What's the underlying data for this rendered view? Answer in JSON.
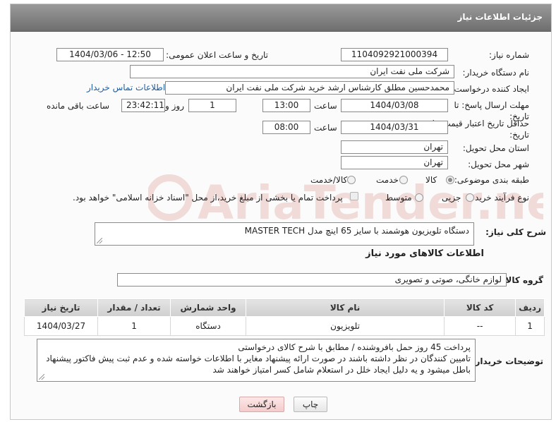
{
  "panel": {
    "title": "جزئیات اطلاعات نیاز"
  },
  "form": {
    "need_number_label": "شماره نیاز:",
    "need_number": "1104092921000394",
    "announce_label": "تاریخ و ساعت اعلان عمومی:",
    "announce_value": "1404/03/06 - 12:50",
    "buyer_org_label": "نام دستگاه خریدار:",
    "buyer_org": "شرکت ملی نفت ایران",
    "requester_label": "ایجاد کننده درخواست:",
    "requester": "محمدحسین مطلق کارشناس ارشد خرید شرکت ملی نفت ایران",
    "contact_link": "اطلاعات تماس خریدار",
    "deadline_label": "مهلت ارسال پاسخ: تا تاریخ:",
    "deadline_date": "1404/03/08",
    "time_word": "ساعت",
    "deadline_time": "13:00",
    "days_value": "1",
    "days_word": "روز و",
    "remaining_time": "23:42:11",
    "remaining_word": "ساعت باقی مانده",
    "validity_label": "حداقل تاریخ اعتبار قیمت: تا تاریخ:",
    "validity_date": "1404/03/31",
    "validity_time": "08:00",
    "province_label": "استان محل تحویل:",
    "province": "تهران",
    "city_label": "شهر محل تحویل:",
    "city": "تهران",
    "category_label": "طبقه بندی موضوعی:",
    "category_options": [
      "کالا",
      "خدمت",
      "کالا/خدمت"
    ],
    "process_label": "نوع فرآیند خرید :",
    "process_options": [
      "جزیی",
      "متوسط"
    ],
    "payment_note": "پرداخت تمام یا بخشی از مبلغ خرید،از محل \"اسناد خزانه اسلامی\" خواهد بود.",
    "description_label": "شرح کلی نیاز:",
    "description": "دستگاه تلویزیون هوشمند با سایز 65 اینچ مدل MASTER TECH"
  },
  "goods": {
    "section_title": "اطلاعات کالاهای مورد نیاز",
    "group_label": "گروه کالا:",
    "group_value": "لوازم خانگی، صوتی و تصویری",
    "table": {
      "headers": [
        "ردیف",
        "کد کالا",
        "نام کالا",
        "واحد شمارش",
        "تعداد / مقدار",
        "تاریخ نیاز"
      ],
      "rows": [
        [
          "1",
          "--",
          "تلویزیون",
          "دستگاه",
          "1",
          "1404/03/27"
        ]
      ]
    }
  },
  "buyer_notes": {
    "label": "توضیحات خریدار:",
    "line1": "پرداخت 45 روز حمل بافروشنده / مطابق با شرح کالای  درخواستی",
    "line2": "تامیین کنندگان در نظر داشته باشند در صورت ارائه پیشنهاد  مغایر با اطلاعات خواسته شده و عدم ثبت پیش فاکتور  پیشنهاد",
    "line3": "باطل میشود و یه دلیل ایجاد خلل در استعلام شامل کسر امتیاز خواهند شد"
  },
  "buttons": {
    "print": "چاپ",
    "back": "بازگشت"
  },
  "watermark": {
    "text": "AriaTender.net"
  }
}
